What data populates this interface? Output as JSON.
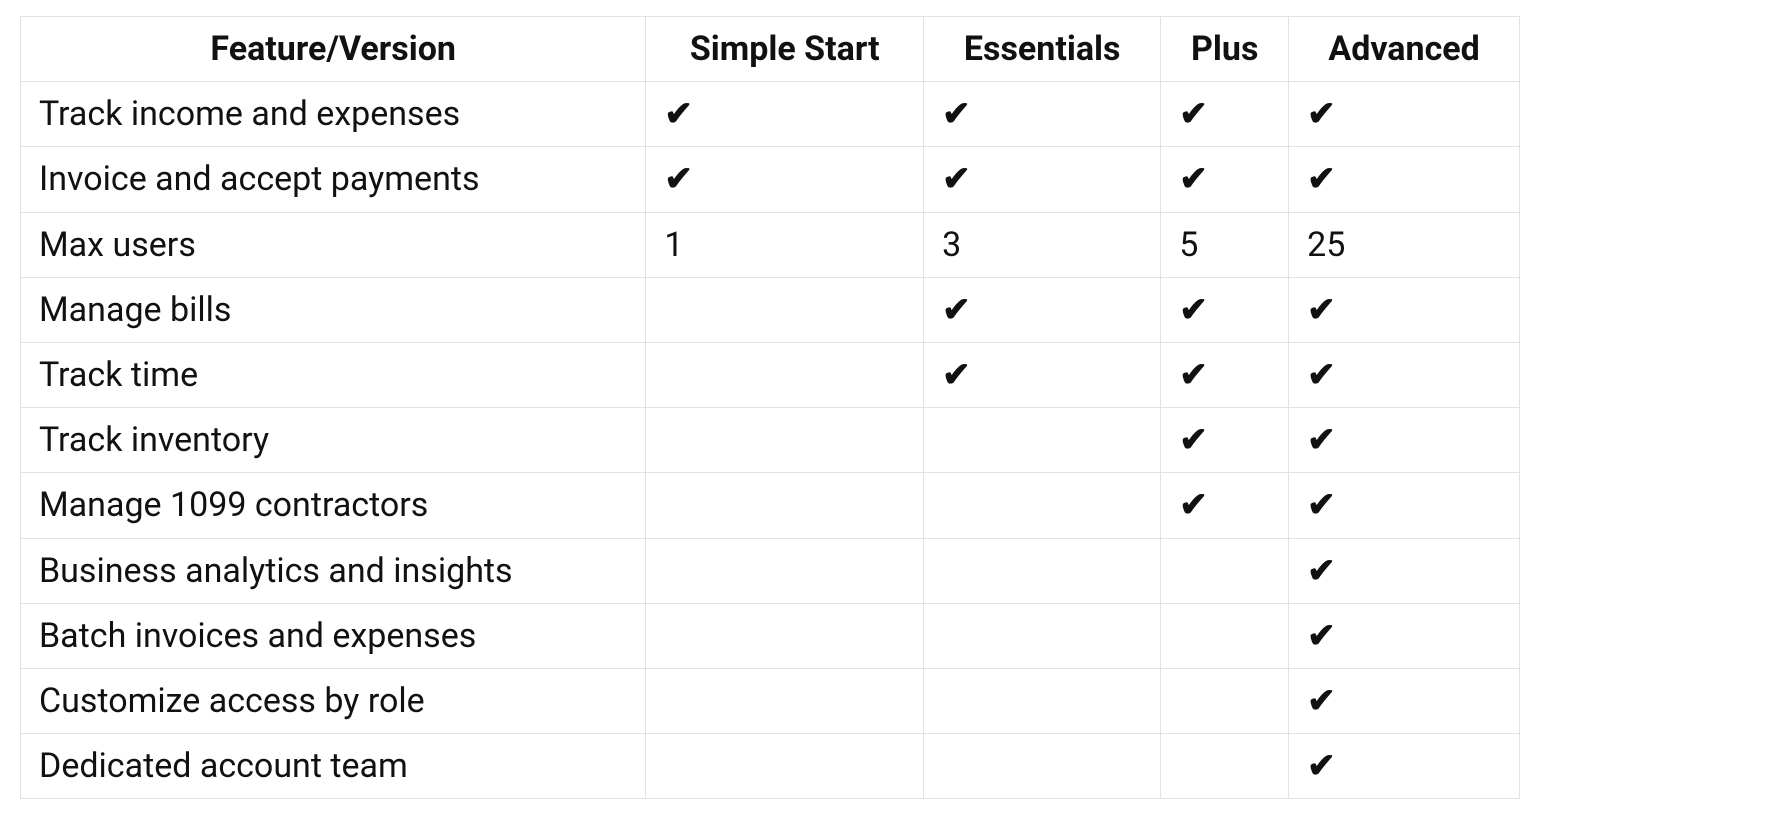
{
  "check_glyph": "✔",
  "columns": [
    "Feature/Version",
    "Simple Start",
    "Essentials",
    "Plus",
    "Advanced"
  ],
  "rows": [
    {
      "feature": "Track income and expenses",
      "cells": [
        "✔",
        "✔",
        "✔",
        "✔"
      ]
    },
    {
      "feature": "Invoice and accept payments",
      "cells": [
        "✔",
        "✔",
        "✔",
        "✔"
      ]
    },
    {
      "feature": "Max users",
      "cells": [
        "1",
        "3",
        "5",
        "25"
      ]
    },
    {
      "feature": "Manage bills",
      "cells": [
        "",
        "✔",
        "✔",
        "✔"
      ]
    },
    {
      "feature": "Track time",
      "cells": [
        "",
        "✔",
        "✔",
        "✔"
      ]
    },
    {
      "feature": "Track inventory",
      "cells": [
        "",
        "",
        "✔",
        "✔"
      ]
    },
    {
      "feature": "Manage 1099 contractors",
      "cells": [
        "",
        "",
        "✔",
        "✔"
      ]
    },
    {
      "feature": "Business analytics and insights",
      "cells": [
        "",
        "",
        "",
        "✔"
      ]
    },
    {
      "feature": "Batch invoices and expenses",
      "cells": [
        "",
        "",
        "",
        "✔"
      ]
    },
    {
      "feature": "Customize access by role",
      "cells": [
        "",
        "",
        "",
        "✔"
      ]
    },
    {
      "feature": "Dedicated account team",
      "cells": [
        "",
        "",
        "",
        "✔"
      ]
    }
  ],
  "chart_data": {
    "type": "table",
    "title": "",
    "columns": [
      "Feature/Version",
      "Simple Start",
      "Essentials",
      "Plus",
      "Advanced"
    ],
    "data": [
      [
        "Track income and expenses",
        true,
        true,
        true,
        true
      ],
      [
        "Invoice and accept payments",
        true,
        true,
        true,
        true
      ],
      [
        "Max users",
        1,
        3,
        5,
        25
      ],
      [
        "Manage bills",
        false,
        true,
        true,
        true
      ],
      [
        "Track time",
        false,
        true,
        true,
        true
      ],
      [
        "Track inventory",
        false,
        false,
        true,
        true
      ],
      [
        "Manage 1099 contractors",
        false,
        false,
        true,
        true
      ],
      [
        "Business analytics and insights",
        false,
        false,
        false,
        true
      ],
      [
        "Batch invoices and expenses",
        false,
        false,
        false,
        true
      ],
      [
        "Customize access by role",
        false,
        false,
        false,
        true
      ],
      [
        "Dedicated account team",
        false,
        false,
        false,
        true
      ]
    ]
  }
}
